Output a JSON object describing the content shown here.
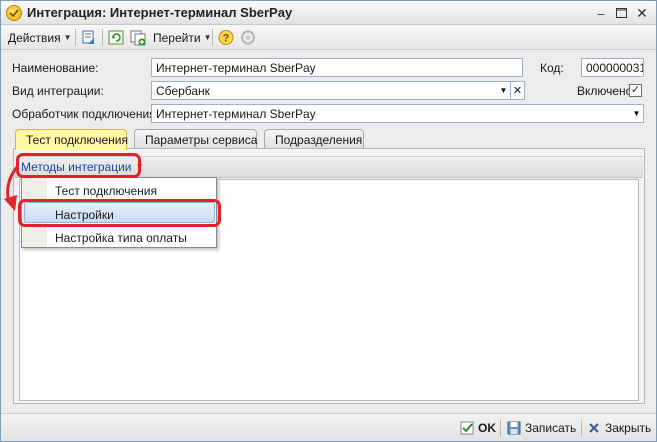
{
  "window": {
    "title": "Интеграция: Интернет-терминал SberPay"
  },
  "toolbar": {
    "actions_label": "Действия",
    "goto_label": "Перейти"
  },
  "form": {
    "name_label": "Наименование:",
    "name_value": "Интернет-терминал SberPay",
    "code_label": "Код:",
    "code_value": "000000031",
    "integration_type_label": "Вид интеграции:",
    "integration_type_value": "Сбербанк",
    "enabled_label": "Включено",
    "enabled_checked": true,
    "handler_label": "Обработчик подключения:",
    "handler_value": "Интернет-терминал SberPay"
  },
  "tabs": [
    {
      "label": "Тест подключения",
      "active": true
    },
    {
      "label": "Параметры сервиса",
      "active": false
    },
    {
      "label": "Подразделения",
      "active": false
    }
  ],
  "panel": {
    "methods_button_label": "Методы интеграции"
  },
  "menu": {
    "items": [
      {
        "label": "Тест подключения"
      },
      {
        "label": "Настройки",
        "highlighted": true
      },
      {
        "label": "Настройка типа оплаты"
      }
    ]
  },
  "bottom": {
    "ok_label": "OK",
    "save_label": "Записать",
    "close_label": "Закрыть"
  },
  "colors": {
    "annotation": "#e1242b",
    "active_tab": "#fdf7a6",
    "link_blue": "#1d46a3"
  },
  "icons": [
    "app-logo-icon",
    "help-icon",
    "settings-disabled-icon",
    "checkmark-icon",
    "save-icon",
    "close-icon"
  ]
}
